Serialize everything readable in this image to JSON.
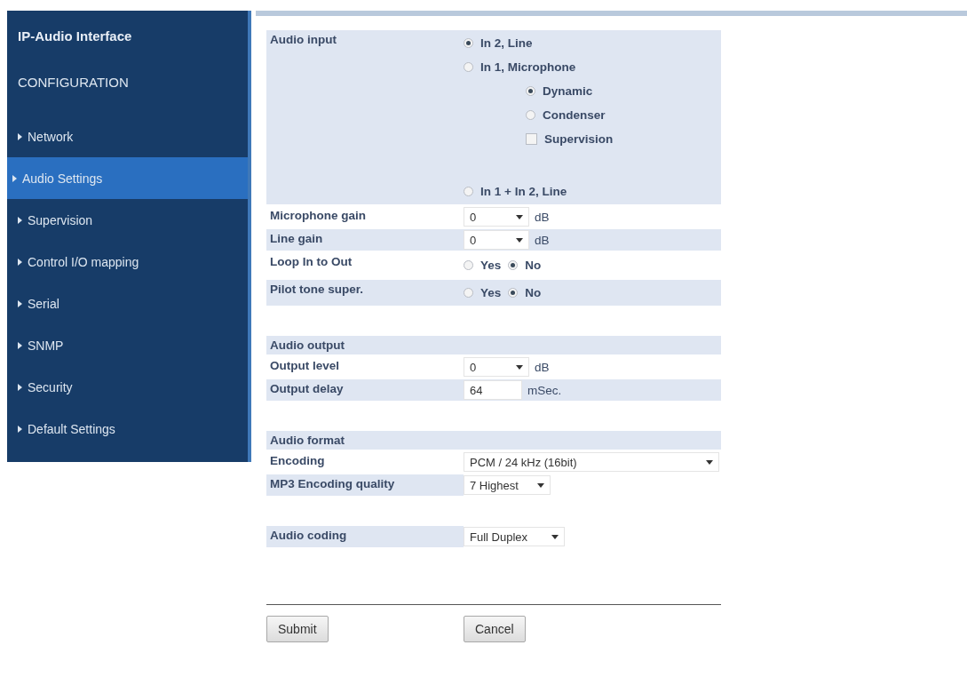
{
  "sidebar": {
    "title": "IP-Audio Interface",
    "section": "CONFIGURATION",
    "items": [
      {
        "label": "Network",
        "selected": false
      },
      {
        "label": "Audio Settings",
        "selected": true
      },
      {
        "label": "Supervision",
        "selected": false
      },
      {
        "label": "Control I/O mapping",
        "selected": false
      },
      {
        "label": "Serial",
        "selected": false
      },
      {
        "label": "SNMP",
        "selected": false
      },
      {
        "label": "Security",
        "selected": false
      },
      {
        "label": "Default Settings",
        "selected": false
      }
    ]
  },
  "form": {
    "sections": [
      {
        "rows": [
          {
            "kind": "radio-group",
            "row_shaded": true,
            "label": "Audio input",
            "options": [
              {
                "label": "In 2, Line",
                "selected": true
              },
              {
                "label": "In 1, Microphone",
                "selected": false,
                "children": [
                  {
                    "kind": "radio",
                    "label": "Dynamic",
                    "selected": true
                  },
                  {
                    "kind": "radio",
                    "label": "Condenser",
                    "selected": false
                  },
                  {
                    "kind": "checkbox",
                    "label": "Supervision",
                    "checked": false
                  }
                ]
              },
              {
                "label": "In 1 + In 2, Line",
                "selected": false
              }
            ]
          },
          {
            "kind": "select",
            "row_shaded": false,
            "label": "Microphone gain",
            "value": "0",
            "unit": "dB"
          },
          {
            "kind": "select",
            "row_shaded": true,
            "label": "Line gain",
            "value": "0",
            "unit": "dB"
          },
          {
            "kind": "choice",
            "row_shaded": false,
            "label": "Loop In to Out",
            "options": [
              {
                "label": "Yes",
                "selected": false
              },
              {
                "label": "No",
                "selected": true
              }
            ]
          },
          {
            "kind": "choice",
            "row_shaded": true,
            "label": "Pilot tone super.",
            "options": [
              {
                "label": "Yes",
                "selected": false
              },
              {
                "label": "No",
                "selected": true
              }
            ]
          }
        ]
      },
      {
        "title": "Audio output",
        "rows": [
          {
            "kind": "select",
            "row_shaded": false,
            "label": "Output level",
            "value": "0",
            "unit": "dB"
          },
          {
            "kind": "text",
            "row_shaded": true,
            "label": "Output delay",
            "value": "64",
            "unit": "mSec."
          }
        ]
      },
      {
        "title": "Audio format",
        "rows": [
          {
            "kind": "wide-select",
            "row_shaded": false,
            "label": "Encoding",
            "value": "PCM / 24 kHz (16bit)"
          },
          {
            "kind": "select",
            "row_shaded": false,
            "label_shaded": true,
            "label": "MP3 Encoding quality",
            "value": "7 Highest"
          }
        ]
      },
      {
        "rows": [
          {
            "kind": "select",
            "row_shaded": false,
            "label_shaded": true,
            "label": "Audio coding",
            "value": "Full Duplex"
          }
        ]
      }
    ]
  },
  "buttons": [
    {
      "label": "Submit"
    },
    {
      "label": "Cancel"
    }
  ]
}
